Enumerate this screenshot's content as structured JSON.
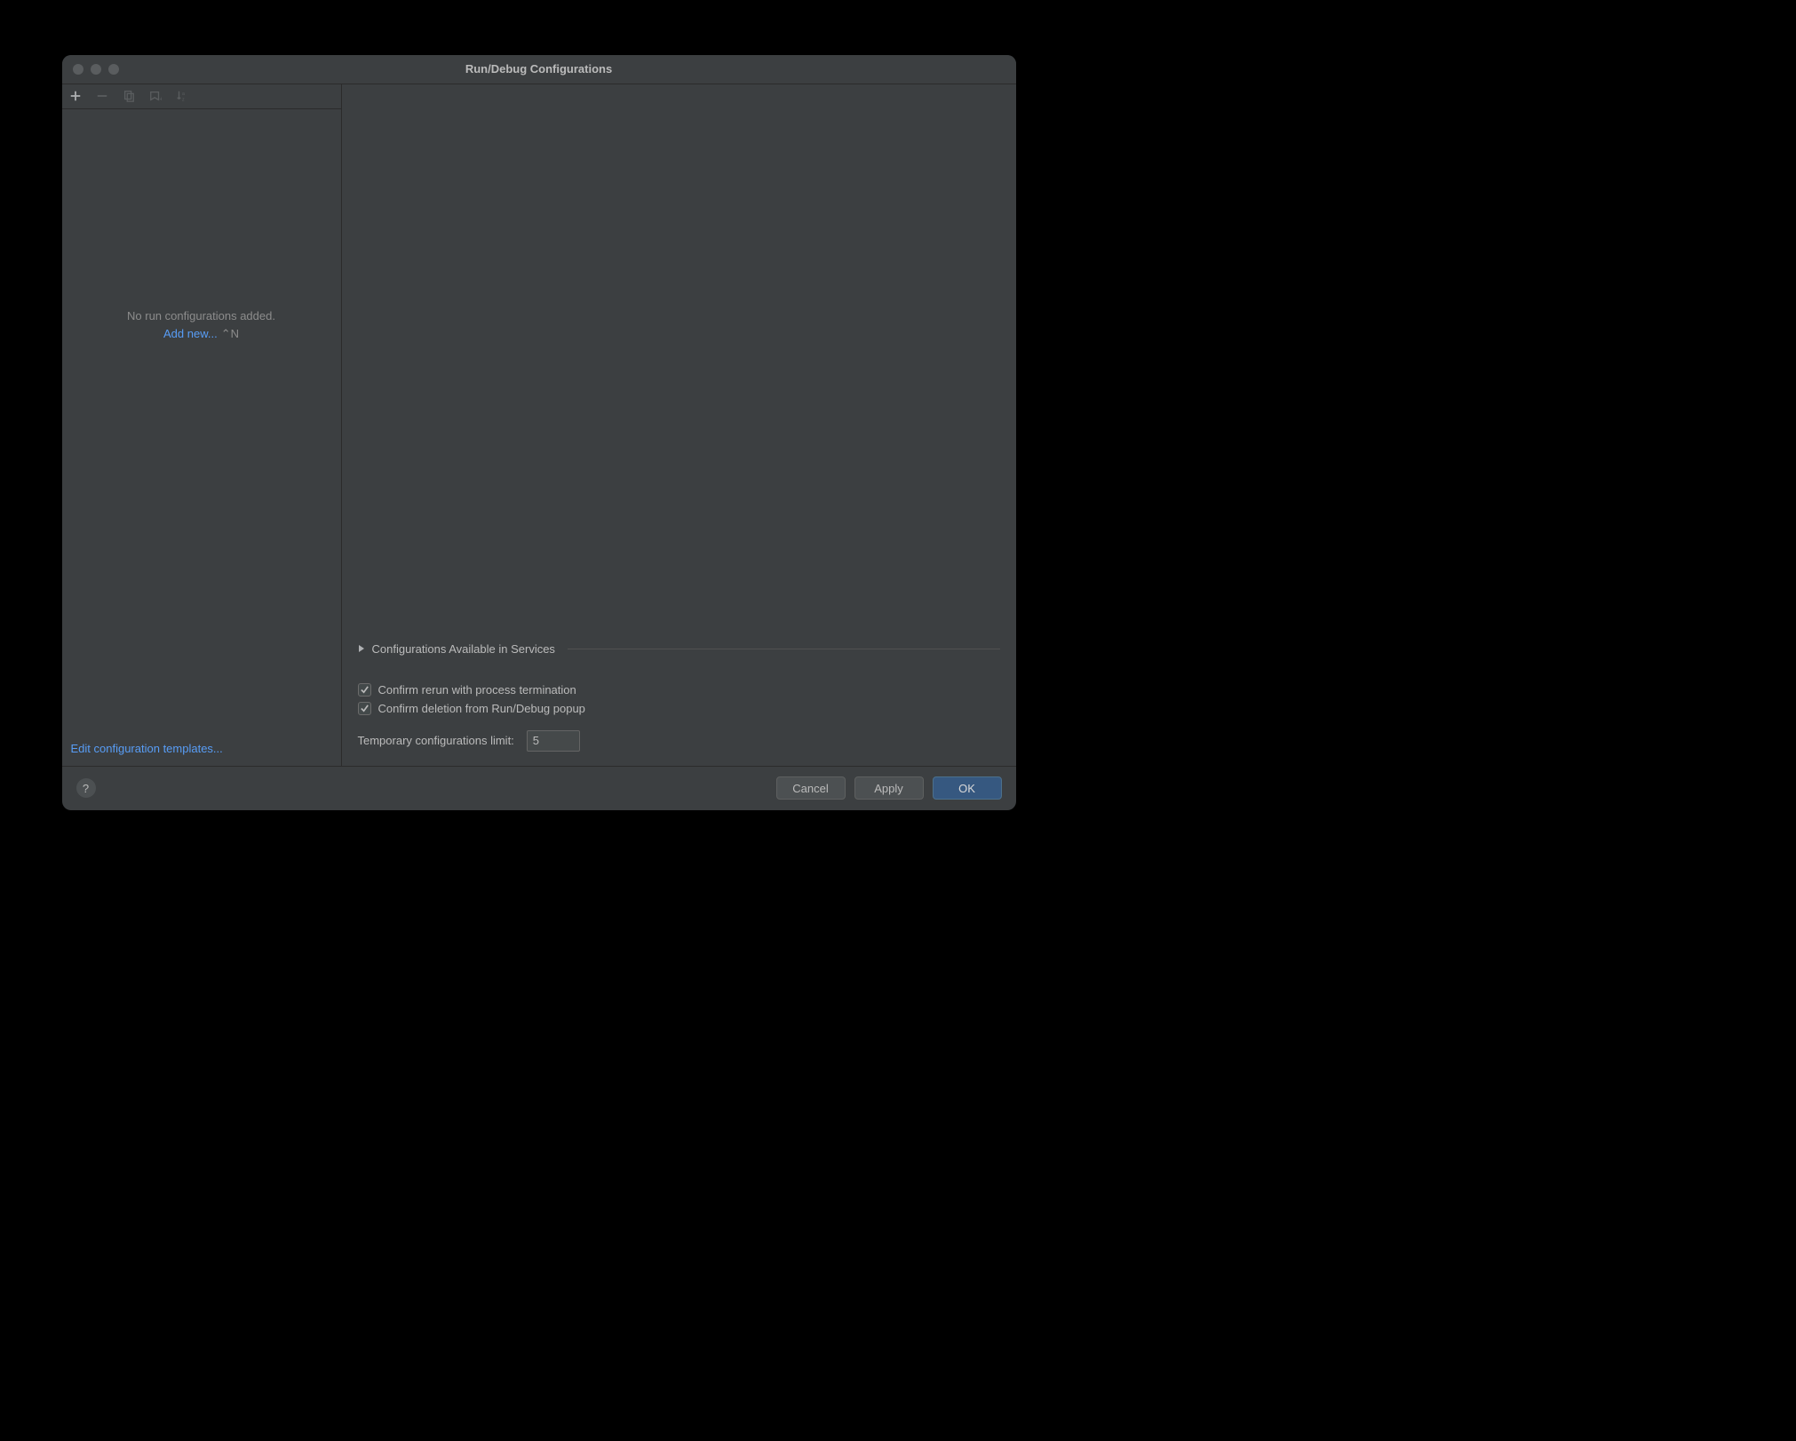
{
  "title": "Run/Debug Configurations",
  "sidebar": {
    "empty_msg": "No run configurations added.",
    "add_new_label": "Add new...",
    "add_new_shortcut": "⌃N",
    "edit_templates_label": "Edit configuration templates..."
  },
  "main": {
    "section_header": "Configurations Available in Services",
    "checkbox_rerun": {
      "checked": true,
      "label": "Confirm rerun with process termination"
    },
    "checkbox_delete": {
      "checked": true,
      "label": "Confirm deletion from Run/Debug popup"
    },
    "limit_label": "Temporary configurations limit:",
    "limit_value": "5"
  },
  "footer": {
    "cancel": "Cancel",
    "apply": "Apply",
    "ok": "OK",
    "help": "?"
  },
  "icons": {
    "add": "add-icon",
    "remove": "remove-icon",
    "copy": "copy-icon",
    "save": "save-template-icon",
    "sort": "sort-alpha-icon",
    "chevron": "chevron-right-icon"
  }
}
